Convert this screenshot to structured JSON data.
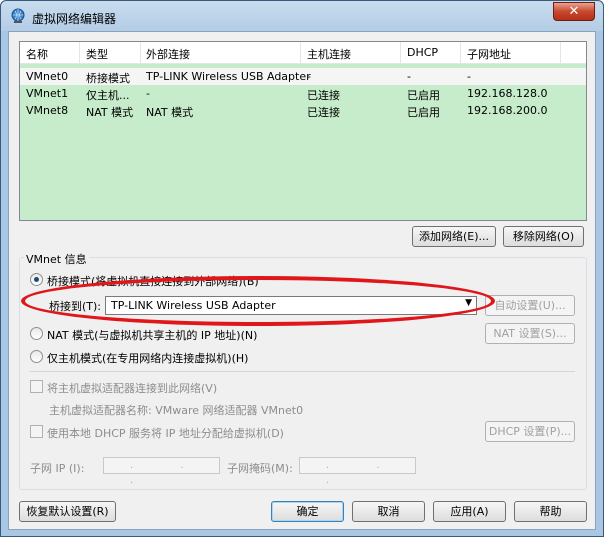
{
  "window": {
    "title": "虚拟网络编辑器",
    "close_glyph": "✕"
  },
  "network_list": {
    "columns": [
      "名称",
      "类型",
      "外部连接",
      "主机连接",
      "DHCP",
      "子网地址"
    ],
    "rows": [
      [
        "VMnet0",
        "桥接模式",
        "TP-LINK Wireless USB Adapter",
        "-",
        "-",
        "-"
      ],
      [
        "VMnet1",
        "仅主机...",
        "-",
        "已连接",
        "已启用",
        "192.168.128.0"
      ],
      [
        "VMnet8",
        "NAT 模式",
        "NAT 模式",
        "已连接",
        "已启用",
        "192.168.200.0"
      ]
    ]
  },
  "list_buttons": {
    "add": "添加网络(E)...",
    "remove": "移除网络(O)"
  },
  "vmnet_info": {
    "title": "VMnet 信息",
    "bridged_label": "桥接模式(将虚拟机直接连接到外部网络)(B)",
    "bridged_to_label": "桥接到(T):",
    "bridged_to_value": "TP-LINK Wireless USB Adapter",
    "auto_settings": "自动设置(U)...",
    "nat_label": "NAT 模式(与虚拟机共享主机的 IP 地址)(N)",
    "nat_settings": "NAT 设置(S)...",
    "hostonly_label": "仅主机模式(在专用网络内连接虚拟机)(H)",
    "connect_adapter_label": "将主机虚拟适配器连接到此网络(V)",
    "adapter_name_label": "主机虚拟适配器名称: VMware 网络适配器 VMnet0",
    "dhcp_label": "使用本地 DHCP 服务将 IP 地址分配给虚拟机(D)",
    "dhcp_settings": "DHCP 设置(P)...",
    "subnet_ip_label": "子网 IP (I):",
    "subnet_mask_label": "子网掩码(M):",
    "ip_placeholder": ". . ."
  },
  "footer": {
    "restore": "恢复默认设置(R)",
    "ok": "确定",
    "cancel": "取消",
    "apply": "应用(A)",
    "help": "帮助"
  },
  "colors": {
    "annotation": "#e0161b",
    "list_bg": "#c6eccb"
  }
}
